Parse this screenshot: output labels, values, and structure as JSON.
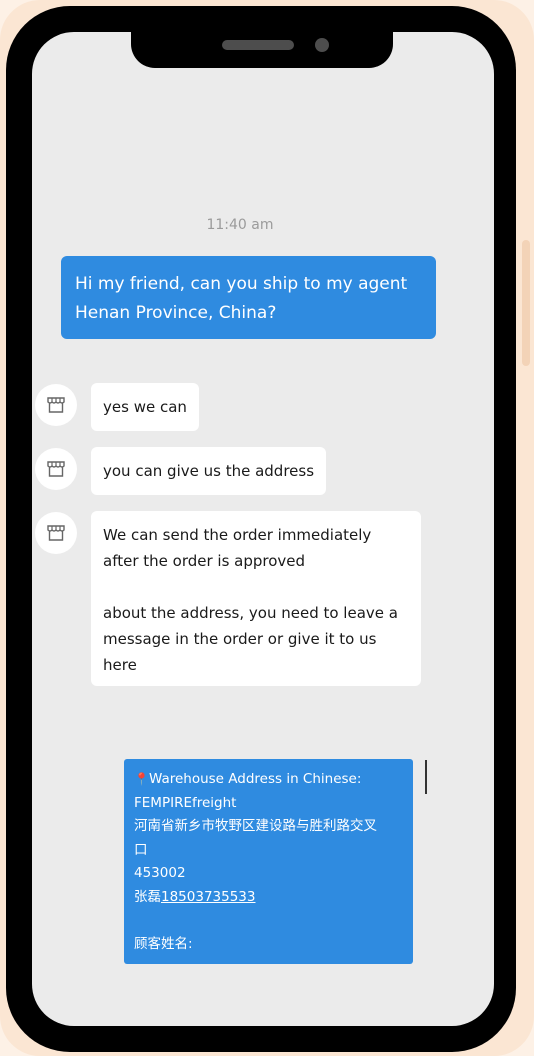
{
  "chat": {
    "timestamp": "11:40 am",
    "outgoing": {
      "line1": "Hi my friend, can you ship to my agent",
      "line2": "Henan Province, China?"
    },
    "incoming": [
      {
        "text": "yes we can"
      },
      {
        "text": "you can give us the address"
      },
      {
        "para1_line1": "We can send the order immediately",
        "para1_line2": "after the order is approved",
        "para2_line1": "about  the address, you need to leave a",
        "para2_line2": "message in the order or give it to us",
        "para2_line3": "here"
      }
    ],
    "address_card": {
      "title": "Warehouse Address in Chinese:",
      "company": "FEMPIREfreight",
      "address_line1": "河南省新乡市牧野区建设路与胜利路交叉",
      "address_line2": "口",
      "postal_code": "453002",
      "contact_name": "张磊",
      "contact_phone": "18503735533",
      "customer_name_label": "顾客姓名:"
    }
  },
  "icons": {
    "store": "store-icon",
    "pin": "location-pin-icon"
  },
  "colors": {
    "accent_blue": "#2f8be0",
    "screen_bg": "#ebebeb",
    "frame": "#000000"
  }
}
